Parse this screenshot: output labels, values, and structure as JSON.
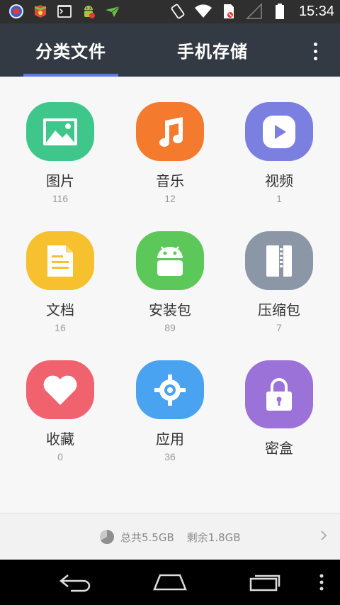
{
  "status_bar": {
    "time": "15:34",
    "left_icons": [
      "record-icon",
      "game-app-icon",
      "terminal-icon",
      "android-debug-icon",
      "paper-plane-icon"
    ],
    "right_icons": [
      "rotate-icon",
      "wifi-icon",
      "sim-icon",
      "signal-icon",
      "battery-icon"
    ]
  },
  "header": {
    "tabs": [
      {
        "label": "分类文件",
        "active": true
      },
      {
        "label": "手机存储",
        "active": false
      }
    ],
    "accent": "#5b7ce0",
    "more_icon": "more-vert-icon"
  },
  "categories": [
    {
      "label": "图片",
      "count": "116",
      "icon": "image-icon",
      "color": "#3ec68b"
    },
    {
      "label": "音乐",
      "count": "12",
      "icon": "music-icon",
      "color": "#f47a2e"
    },
    {
      "label": "视频",
      "count": "1",
      "icon": "video-icon",
      "color": "#7b7fe0"
    },
    {
      "label": "文档",
      "count": "16",
      "icon": "document-icon",
      "color": "#f7c02e"
    },
    {
      "label": "安装包",
      "count": "89",
      "icon": "android-icon",
      "color": "#5dc85a"
    },
    {
      "label": "压缩包",
      "count": "7",
      "icon": "archive-icon",
      "color": "#8b97a7"
    },
    {
      "label": "收藏",
      "count": "0",
      "icon": "heart-icon",
      "color": "#f0626e"
    },
    {
      "label": "应用",
      "count": "36",
      "icon": "app-icon",
      "color": "#4aa3f0"
    },
    {
      "label": "密盒",
      "count": "",
      "icon": "lock-icon",
      "color": "#9b72d8"
    }
  ],
  "storage": {
    "total": "总共5.5GB",
    "remaining": "剩余1.8GB",
    "used_fraction": 0.67
  },
  "nav": [
    "back-icon",
    "home-icon",
    "recents-icon",
    "menu-icon"
  ]
}
